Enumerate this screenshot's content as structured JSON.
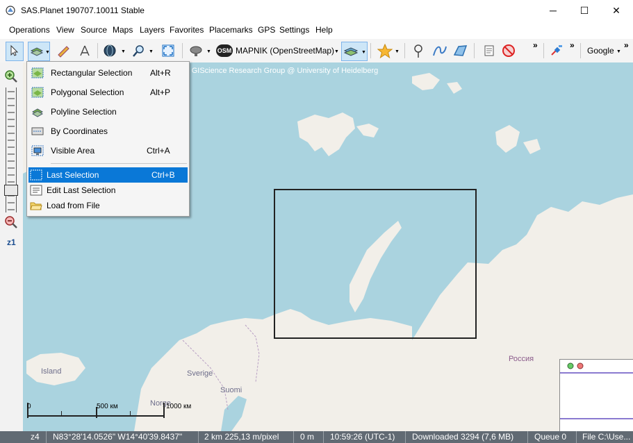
{
  "window": {
    "title": "SAS.Planet 190707.10011 Stable",
    "minimize": "─",
    "maximize": "☐",
    "close": "✕"
  },
  "menu": [
    "Operations",
    "View",
    "Source",
    "Maps",
    "Layers",
    "Favorites",
    "Placemarks",
    "GPS",
    "Settings",
    "Help"
  ],
  "toolbar": {
    "map_source": "MAPNIK (OpenStreetMap)",
    "osm_badge": "OSM",
    "overflow1": "»",
    "overflow2": "»",
    "overflow3": "»",
    "search_provider": "Google"
  },
  "selection_menu": {
    "items": [
      {
        "label": "Rectangular Selection",
        "shortcut": "Alt+R"
      },
      {
        "label": "Polygonal Selection",
        "shortcut": "Alt+P"
      },
      {
        "label": "Polyline Selection",
        "shortcut": ""
      },
      {
        "label": "By Coordinates",
        "shortcut": ""
      },
      {
        "label": "Visible Area",
        "shortcut": "Ctrl+A"
      },
      {
        "label": "Last Selection",
        "shortcut": "Ctrl+B"
      },
      {
        "label": "Edit Last Selection",
        "shortcut": ""
      },
      {
        "label": "Load from File",
        "shortcut": ""
      }
    ],
    "highlighted_index": 5
  },
  "zoom": {
    "level_label": "z1"
  },
  "map": {
    "attribution": "ing GIScience Research Group @ University of Heidelberg",
    "labels": {
      "iceland": "Island",
      "sweden": "Sverige",
      "finland": "Suomi",
      "russia": "Россия",
      "norway": "Norge"
    },
    "scale": {
      "start": "0",
      "mid": "500 км",
      "end": "1000 км"
    }
  },
  "status": {
    "zoom": "z4",
    "coords": "N83°28'14.0526\" W14°40'39.8437\"",
    "resolution": "2 km 225,13 m/pixel",
    "altitude": "0 m",
    "time": "10:59:26 (UTC-1)",
    "downloaded": "Downloaded 3294 (7,6 MB)",
    "queue": "Queue 0",
    "file": "File C:\\Use..."
  },
  "colors": {
    "water": "#aad3df",
    "land": "#f2efe9",
    "highlight": "#0a78d7",
    "statusbar": "#616a73"
  }
}
